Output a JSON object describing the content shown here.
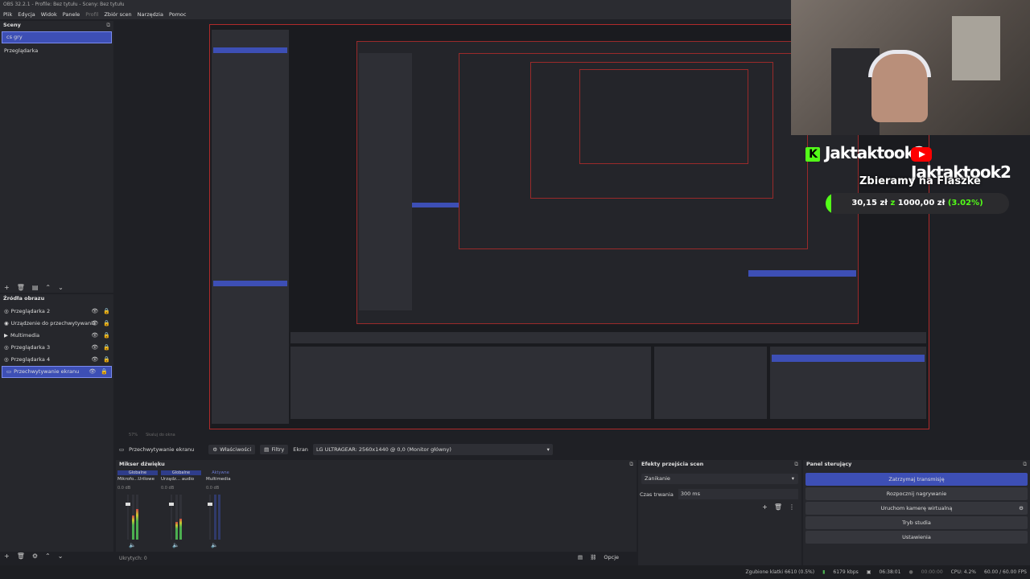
{
  "window": {
    "title": "OBS 32.2.1 - Profile: Bez tytułu - Sceny: Bez tytułu"
  },
  "menu": [
    "Plik",
    "Edycja",
    "Widok",
    "Panele",
    "Profil",
    "Zbiór scen",
    "Narzędzia",
    "Pomoc"
  ],
  "scenes": {
    "title": "Sceny",
    "items": [
      "cs gry",
      "Przeglądarka"
    ]
  },
  "sources": {
    "title": "Źródła obrazu",
    "items": [
      "Przeglądarka 2",
      "Urządzenie do przechwytywania",
      "Multimedia",
      "Przeglądarka 3",
      "Przeglądarka 4",
      "Przechwytywanie ekranu"
    ]
  },
  "source_toolbar": {
    "name": "Przechwytywanie ekranu",
    "properties": "Właściwości",
    "filters": "Filtry",
    "screen_label": "Ekran",
    "screen_value": "LG ULTRAGEAR: 2560x1440 @ 0,0 (Monitor główny)"
  },
  "mixer": {
    "title": "Mikser dźwięku",
    "channels": [
      {
        "group": "Globalne",
        "name": "Mikrofo...Urilowe",
        "db": "0.0 dB"
      },
      {
        "group": "Globalne",
        "name": "Urządz... audio",
        "db": "0.0 dB"
      },
      {
        "group": "Aktywne",
        "name": "Multimedia",
        "db": "0.0 dB"
      }
    ],
    "hidden": "Ukrytych: 0",
    "options": "Opcje"
  },
  "transitions": {
    "title": "Efekty przejścia scen",
    "type": "Zanikanie",
    "duration_label": "Czas trwania",
    "duration_value": "300 ms"
  },
  "controls": {
    "title": "Panel sterujący",
    "stop_stream": "Zatrzymaj transmisję",
    "start_record": "Rozpocznij nagrywanie",
    "virtual_cam": "Uruchom kamerę wirtualną",
    "studio": "Tryb studia",
    "settings": "Ustawienia"
  },
  "status": {
    "dropped": "Zgubione klatki 6610 (0.5%)",
    "bitrate": "6179 kbps",
    "live_time": "06:38:01",
    "rec_time": "00:00:00",
    "cpu": "CPU: 4.2%",
    "fps": "60.00 / 60.00 FPS"
  },
  "overlay": {
    "kick_name": "Jaktaktook2",
    "yt_name": "Jaktaktook2",
    "goal_title": "Zbieramy na Flaszke",
    "goal_current": "30,15 zł",
    "goal_sep": "z",
    "goal_target": "1000,00 zł",
    "goal_pct": "(3.02%)"
  },
  "preview_status": {
    "zoom": "57%",
    "fit": "Skaluj do okna"
  },
  "colors": {
    "accent": "#3d4fb5",
    "kick": "#53fc18",
    "youtube": "#ff0000"
  }
}
